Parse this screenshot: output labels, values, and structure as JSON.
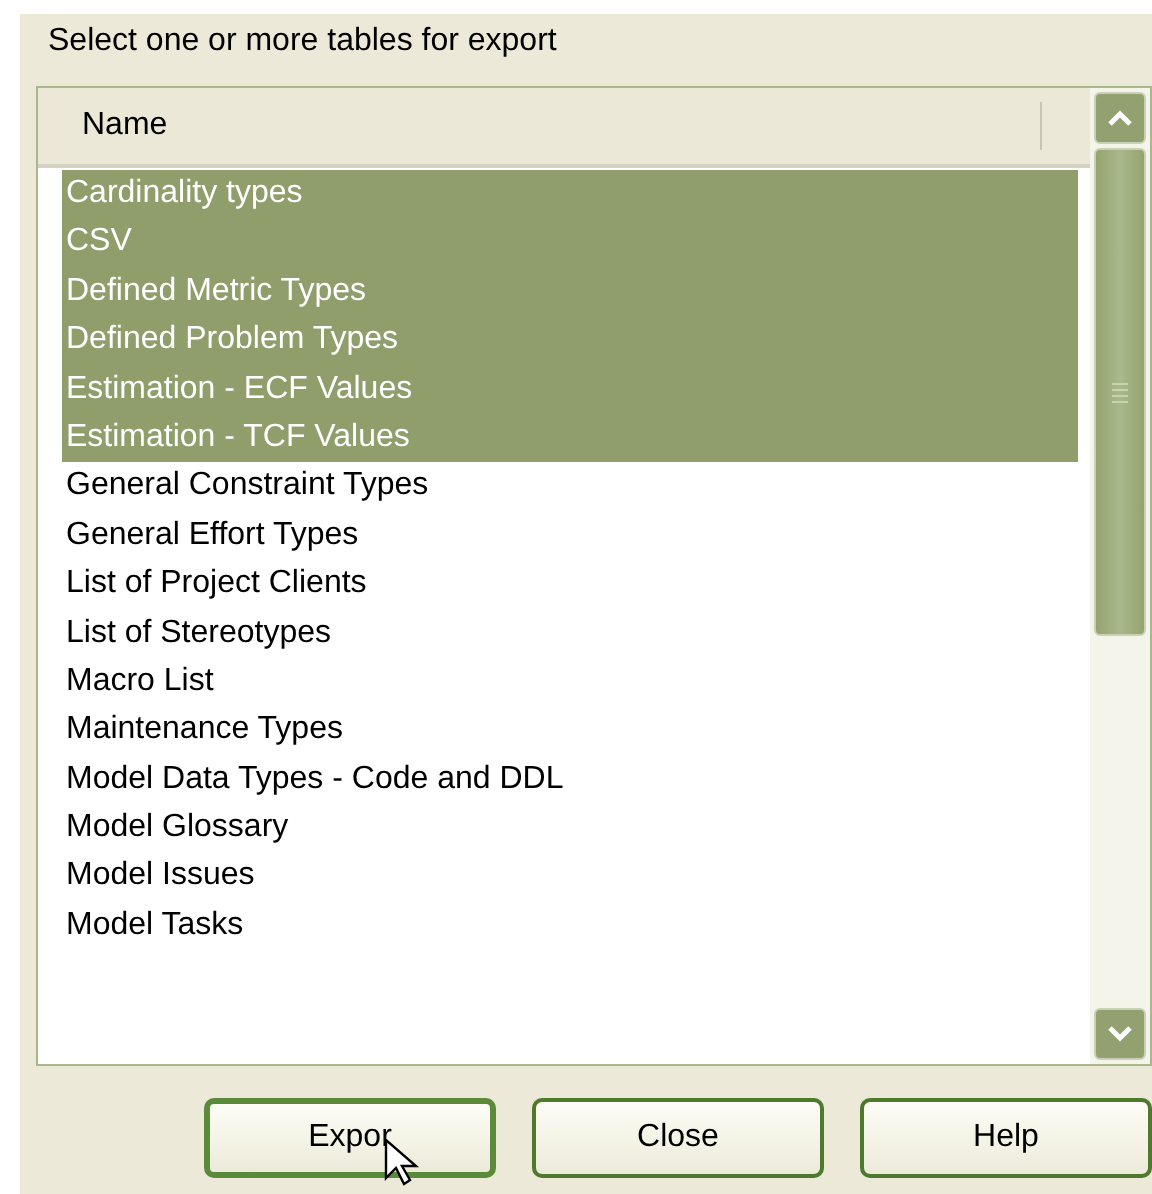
{
  "prompt": "Select one or more tables for export",
  "table": {
    "columns": [
      "Name"
    ],
    "rows": [
      {
        "name": "Cardinality types",
        "selected": true
      },
      {
        "name": "CSV",
        "selected": true
      },
      {
        "name": "Defined Metric Types",
        "selected": true
      },
      {
        "name": "Defined Problem Types",
        "selected": true
      },
      {
        "name": "Estimation - ECF Values",
        "selected": true
      },
      {
        "name": "Estimation - TCF Values",
        "selected": true
      },
      {
        "name": "General Constraint Types",
        "selected": false
      },
      {
        "name": "General Effort Types",
        "selected": false
      },
      {
        "name": "List of Project Clients",
        "selected": false
      },
      {
        "name": "List of Stereotypes",
        "selected": false
      },
      {
        "name": "Macro List",
        "selected": false
      },
      {
        "name": "Maintenance Types",
        "selected": false
      },
      {
        "name": "Model Data Types - Code and DDL",
        "selected": false
      },
      {
        "name": "Model Glossary",
        "selected": false
      },
      {
        "name": "Model Issues",
        "selected": false
      },
      {
        "name": "Model Tasks",
        "selected": false
      }
    ]
  },
  "buttons": [
    {
      "label": "Expor",
      "focused": true
    },
    {
      "label": "Close",
      "focused": false
    },
    {
      "label": "Help",
      "focused": false
    }
  ]
}
